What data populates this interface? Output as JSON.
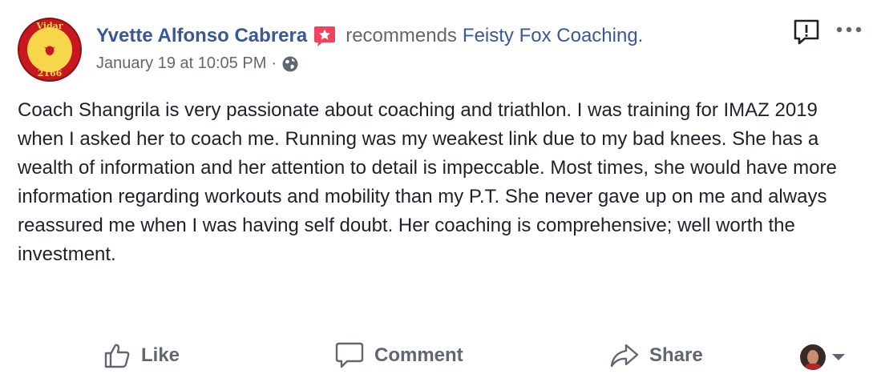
{
  "post": {
    "author": "Yvette Alfonso Cabrera",
    "action_text": "recommends",
    "page": "Feisty Fox Coaching.",
    "timestamp": "January 19 at 10:05 PM",
    "separator": "·",
    "privacy_icon": "globe-icon",
    "avatar": {
      "top_text": "Vidar",
      "bottom_text": "2166"
    },
    "body": "Coach Shangrila is very passionate about coaching and triathlon. I was training for IMAZ 2019 when I asked her to coach me. Running was my weakest link due to my bad knees. She has a wealth of information and her attention to detail is impeccable. Most times, she would have more information regarding workouts and mobility than my P.T. She never gave up on me and always reassured me when I was having self doubt. Her coaching is comprehensive; well worth the investment."
  },
  "actions": {
    "like": "Like",
    "comment": "Comment",
    "share": "Share"
  },
  "colors": {
    "link": "#385898",
    "secondary": "#606770",
    "text": "#1d2129",
    "recommend_badge": "#f3425f"
  }
}
